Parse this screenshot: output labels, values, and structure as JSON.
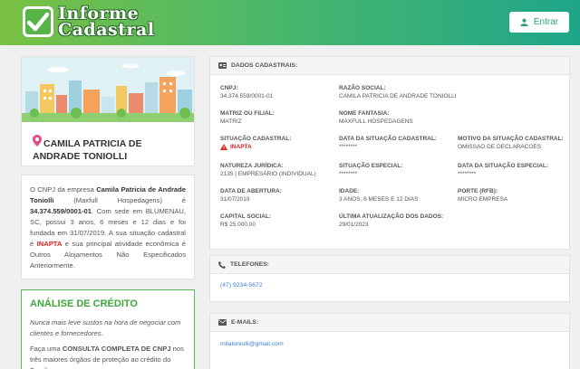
{
  "header": {
    "logo_line1": "Informe",
    "logo_line2": "Cadastral",
    "login_label": "Entrar"
  },
  "profile": {
    "name": "CAMILA PATRICIA DE ANDRADE TONIOLLI"
  },
  "description": {
    "p1": "O CNPJ da empresa ",
    "company": "Camila Patricia de Andrade Toniolli",
    "p2": " (Maxfull Hospedagens) é ",
    "cnpj": "34.374.559/0001-01",
    "p3": ". Com sede em BLUMENAU, SC, possui 3 anos, 6 meses e 12 dias e foi fundada em 31/07/2019. A sua situação cadastral é ",
    "status": "INAPTA",
    "p4": " e sua principal atividade econômica é Outros Alojamentos Não Especificados Anteriormente."
  },
  "credit": {
    "title": "ANÁLISE DE CRÉDITO",
    "tagline": "Nunca mais leve sustos na hora de negociar com clientes e fornecedores.",
    "text1": "Faça uma ",
    "strong": "CONSULTA COMPLETA DE CNPJ",
    "text2": " nos três maiores órgãos de proteção ao crédito do Brasil."
  },
  "dados": {
    "title": "DADOS CADASTRAIS:",
    "fields": {
      "cnpj": {
        "label": "CNPJ:",
        "value": "34.374.559/0001-01"
      },
      "razao": {
        "label": "RAZÃO SOCIAL:",
        "value": "CAMILA PATRICIA DE ANDRADE TONIOLLI"
      },
      "matriz": {
        "label": "MATRIZ OU FILIAL:",
        "value": "MATRIZ"
      },
      "fantasia": {
        "label": "NOME FANTASIA:",
        "value": "MAXFULL HOSPEDAGENS"
      },
      "situacao": {
        "label": "SITUAÇÃO CADASTRAL:",
        "value": "INAPTA"
      },
      "data_situacao": {
        "label": "DATA DA SITUAÇÃO CADASTRAL:",
        "value": "********"
      },
      "motivo": {
        "label": "MOTIVO DA SITUAÇÃO CADASTRAL:",
        "value": "OMISSAO DE DECLARACOES"
      },
      "natureza": {
        "label": "NATUREZA JURÍDICA:",
        "value": "2135 | EMPRESÁRIO (INDIVIDUAL)"
      },
      "especial": {
        "label": "SITUAÇÃO ESPECIAL:",
        "value": "********"
      },
      "data_especial": {
        "label": "DATA DA SITUAÇÃO ESPECIAL:",
        "value": "********"
      },
      "abertura": {
        "label": "DATA DE ABERTURA:",
        "value": "31/07/2019"
      },
      "idade": {
        "label": "IDADE:",
        "value": "3 ANOS, 6 MESES E 12 DIAS"
      },
      "porte": {
        "label": "PORTE (RFB):",
        "value": "MICRO EMPRESA"
      },
      "capital": {
        "label": "CAPITAL SOCIAL:",
        "value": "R$ 25.000,00"
      },
      "atualizacao": {
        "label": "ÚLTIMA ATUALIZAÇÃO DOS DADOS:",
        "value": "29/01/2023"
      }
    }
  },
  "telefones": {
    "title": "TELEFONES:",
    "phone": "(47) 9234-5672"
  },
  "emails": {
    "title": "E-MAILS:",
    "email": "milatoniolli@gmail.com"
  },
  "colors": {
    "accent": "#4cb86a",
    "danger": "#e02020",
    "link": "#3b7dd8"
  }
}
